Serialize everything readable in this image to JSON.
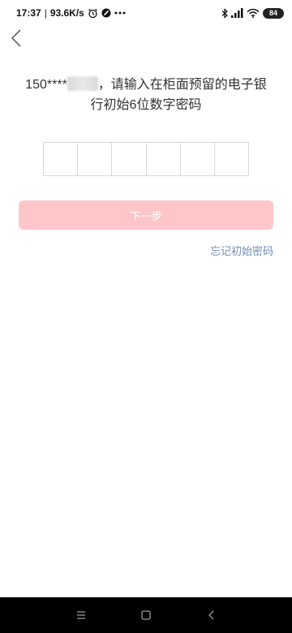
{
  "status_bar": {
    "time": "17:37",
    "speed": "93.6K/s",
    "battery": "84",
    "icons": [
      "alarm-icon",
      "dnd-icon",
      "more-dots-icon",
      "bluetooth-icon",
      "signal-icon",
      "wifi-icon",
      "battery-icon"
    ]
  },
  "header": {
    "back_icon": "chevron-left-icon"
  },
  "prompt": {
    "phone_prefix": "150****",
    "line1_suffix": "，请输入在柜面预留的电子银",
    "line2": "行初始6位数字密码"
  },
  "code_input": {
    "length": 6
  },
  "next_button": {
    "label": "下一步"
  },
  "forgot_link": {
    "label": "忘记初始密码"
  },
  "nav": {
    "icons": [
      "menu-icon",
      "home-icon",
      "back-icon"
    ]
  },
  "colors": {
    "button_bg": "#ffc6c9",
    "link": "#6d8fb8",
    "nav_bg": "#000000"
  }
}
